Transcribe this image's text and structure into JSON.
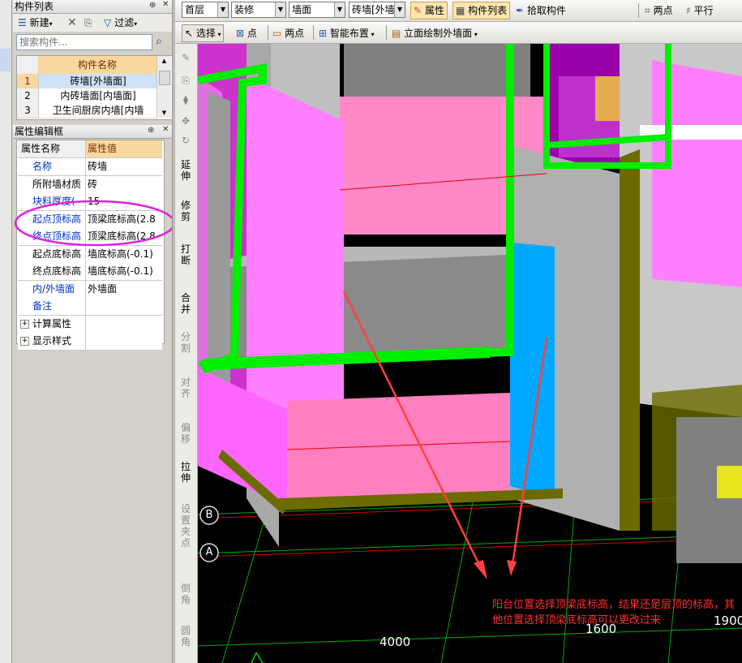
{
  "component_list": {
    "title": "构件列表",
    "new_label": "新建",
    "filter_label": "过滤",
    "search_placeholder": "搜索构件...",
    "column_header": "构件名称",
    "rows": [
      {
        "num": "1",
        "name": "砖墙[外墙面]"
      },
      {
        "num": "2",
        "name": "内砖墙面[内墙面]"
      },
      {
        "num": "3",
        "name": "卫生间厨房内墙[内墙"
      }
    ]
  },
  "property_editor": {
    "title": "属性编辑框",
    "col_name": "属性名称",
    "col_value": "属性值",
    "rows": [
      {
        "name": "名称",
        "value": "砖墙"
      },
      {
        "name": "所附墙材质",
        "value": "砖"
      },
      {
        "name": "块料厚度(",
        "value": "15"
      },
      {
        "name": "起点顶标高",
        "value": "顶梁底标高(2.8"
      },
      {
        "name": "终点顶标高",
        "value": "顶梁底标高(2.8"
      },
      {
        "name": "起点底标高",
        "value": "墙底标高(-0.1)"
      },
      {
        "name": "终点底标高",
        "value": "墙底标高(-0.1)"
      },
      {
        "name": "内/外墙面",
        "value": "外墙面"
      },
      {
        "name": "备注",
        "value": ""
      },
      {
        "name": "计算属性",
        "value": ""
      },
      {
        "name": "显示样式",
        "value": ""
      }
    ]
  },
  "toolbar": {
    "floor": "首层",
    "category": "装修",
    "type": "墙面",
    "component": "砖墙[外墙",
    "properties_label": "属性",
    "component_list_label": "构件列表",
    "pick_label": "拾取构件",
    "two_point_label": "两点",
    "parallel_label": "平行",
    "select_label": "选择",
    "point_label": "点",
    "two_point2_label": "两点",
    "smart_layout_label": "智能布置",
    "elevation_label": "立面绘制外墙面"
  },
  "side_tools": [
    "延伸",
    "修剪",
    "打断",
    "合并",
    "分割",
    "对齐",
    "偏移",
    "拉伸",
    "设置夹点",
    "倒角",
    "圆角"
  ],
  "viewport": {
    "axis_b": "B",
    "axis_a": "A",
    "dim_4000": "4000",
    "dim_1600": "1600",
    "dim_1900": "1900",
    "annotation": "阳台位置选择顶梁底标高，结果还是层顶的标高，其他位置选择顶梁底标高可以更改过来"
  }
}
